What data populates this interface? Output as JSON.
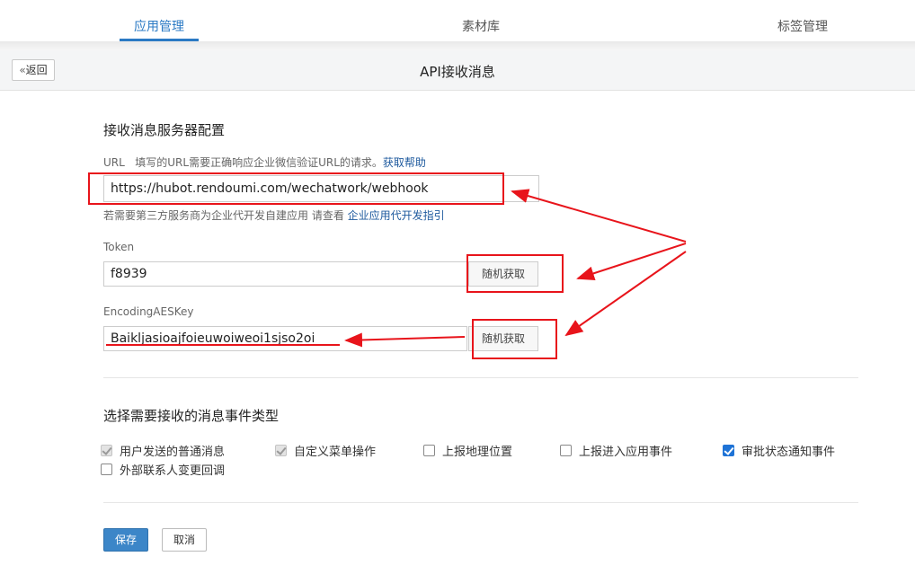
{
  "nav": {
    "tabs": [
      {
        "label": "应用管理",
        "active": true
      },
      {
        "label": "素材库",
        "active": false
      },
      {
        "label": "标签管理",
        "active": false
      }
    ]
  },
  "header": {
    "back_label": "返回",
    "back_icon": "double-chevron-left-icon",
    "title": "API接收消息"
  },
  "server_config": {
    "title": "接收消息服务器配置",
    "url_label": "URL",
    "url_desc": "填写的URL需要正确响应企业微信验证URL的请求。",
    "url_help_link": "获取帮助",
    "url_value": "https://hubot.rendoumi.com/wechatwork/webhook",
    "third_party_hint": "若需要第三方服务商为企业代开发自建应用 请查看",
    "third_party_link": "企业应用代开发指引",
    "token_label": "Token",
    "token_value": "f8939",
    "token_random_label": "随机获取",
    "aeskey_label": "EncodingAESKey",
    "aeskey_value": "Baikljasioajfoieuwoiweoi1sjso2oi",
    "aeskey_random_label": "随机获取"
  },
  "events": {
    "title": "选择需要接收的消息事件类型",
    "items": [
      {
        "label": "用户发送的普通消息",
        "checked": true,
        "disabled": true
      },
      {
        "label": "自定义菜单操作",
        "checked": true,
        "disabled": true
      },
      {
        "label": "上报地理位置",
        "checked": false,
        "disabled": false
      },
      {
        "label": "上报进入应用事件",
        "checked": false,
        "disabled": false
      },
      {
        "label": "审批状态通知事件",
        "checked": true,
        "disabled": false
      },
      {
        "label": "外部联系人变更回调",
        "checked": false,
        "disabled": false
      }
    ]
  },
  "actions": {
    "save_label": "保存",
    "cancel_label": "取消"
  },
  "colors": {
    "accent": "#2b7ac4",
    "annotation": "#e8141b"
  }
}
